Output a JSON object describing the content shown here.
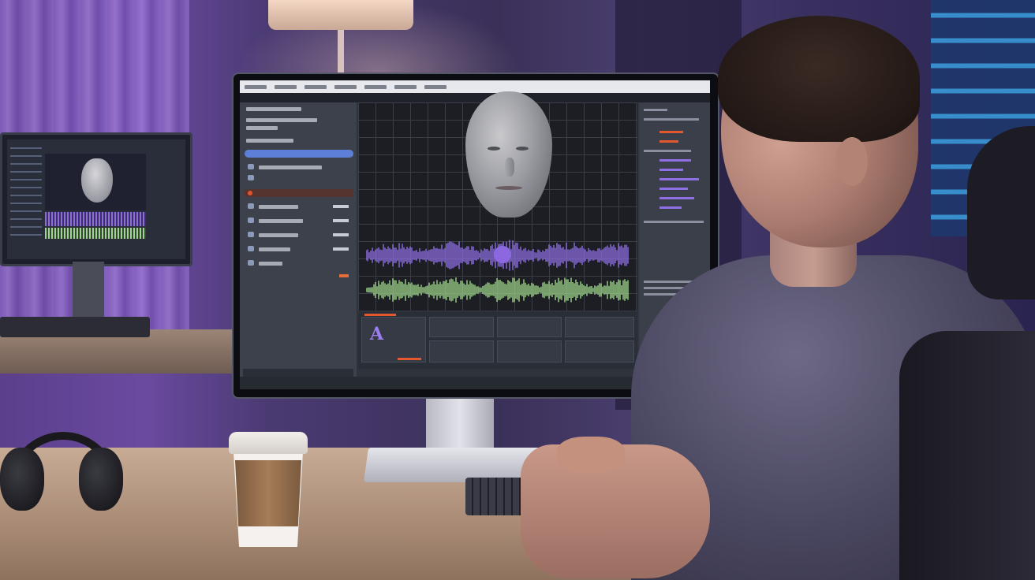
{
  "scene": {
    "description_items": {
      "background_monitor": "bg-monitor",
      "main_monitor": "main-monitor",
      "coffee_cup": "coffee-cup",
      "headphones": "headphones",
      "keyboard": "keyboard",
      "person": "person"
    }
  },
  "screen": {
    "menu_items": [
      "",
      "",
      "",
      "",
      "",
      "",
      "",
      ""
    ],
    "sidebar_rows": 10,
    "bottom_logo": "A"
  },
  "colors": {
    "waveform_purple": "#8f6fe4",
    "waveform_green": "#9fd68a",
    "accent_blue": "#5e7fd8",
    "accent_red": "#e3582f",
    "room_purple": "#6a4aa0"
  },
  "icons": [
    "face-model-icon",
    "waveform-icon",
    "playhead-icon"
  ]
}
